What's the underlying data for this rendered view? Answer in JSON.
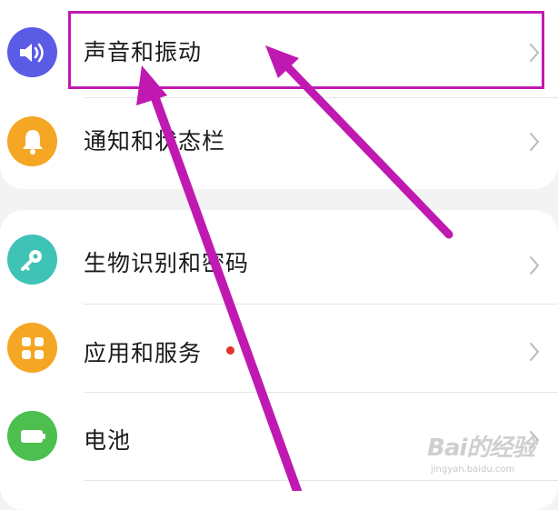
{
  "settings": {
    "group1": [
      {
        "label": "声音和振动",
        "icon": "speaker-icon",
        "color": "#5b5ce6"
      },
      {
        "label": "通知和状态栏",
        "icon": "bell-icon",
        "color": "#f5a623"
      }
    ],
    "group2": [
      {
        "label": "生物识别和密码",
        "icon": "key-icon",
        "color": "#3fc3b6"
      },
      {
        "label": "应用和服务",
        "icon": "apps-grid-icon",
        "color": "#f5a623",
        "badge": true
      },
      {
        "label": "电池",
        "icon": "battery-icon",
        "color": "#4cbf4f"
      }
    ]
  },
  "annotation": {
    "color": "#c019b2"
  },
  "watermark": {
    "main": "Bai的经验",
    "sub": "jingyan.baidu.com"
  }
}
